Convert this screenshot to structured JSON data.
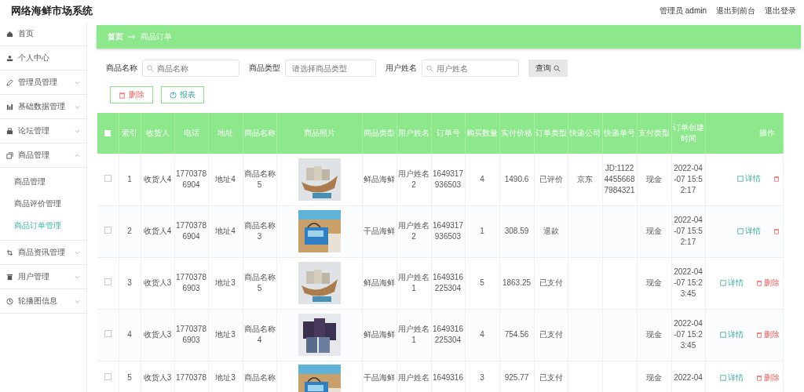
{
  "header": {
    "title": "网络海鲜市场系统",
    "user": "管理员 admin",
    "links": [
      "退出到前台",
      "退出登录"
    ]
  },
  "sidebar": {
    "items": [
      {
        "label": "首页"
      },
      {
        "label": "个人中心"
      },
      {
        "label": "管理员管理",
        "expanded": false
      },
      {
        "label": "基础数据管理",
        "expanded": false
      },
      {
        "label": "论坛管理",
        "expanded": false
      },
      {
        "label": "商品管理",
        "expanded": true,
        "children": [
          {
            "label": "商品管理",
            "selected": false
          },
          {
            "label": "商品评价管理",
            "selected": false
          },
          {
            "label": "商品订单管理",
            "selected": true
          }
        ]
      },
      {
        "label": "商品资讯管理",
        "expanded": false
      },
      {
        "label": "用户管理",
        "expanded": false
      },
      {
        "label": "轮播图信息",
        "expanded": false
      }
    ]
  },
  "breadcrumb": [
    "首页",
    "商品订单"
  ],
  "search": {
    "fields": [
      {
        "label": "商品名称",
        "placeholder": "商品名称",
        "kind": "input"
      },
      {
        "label": "商品类型",
        "placeholder": "请选择商品类型",
        "kind": "select"
      },
      {
        "label": "用户姓名",
        "placeholder": "用户姓名",
        "kind": "input"
      }
    ],
    "button": "查询"
  },
  "actions": {
    "delete": "删除",
    "report": "报表"
  },
  "table": {
    "all_checked": false,
    "columns": [
      "索引",
      "收货人",
      "电话",
      "地址",
      "商品名称",
      "商品照片",
      "商品类型",
      "用户姓名",
      "订单号",
      "购买数量",
      "实付价格",
      "订单类型",
      "快递公司",
      "快递单号",
      "支付类型",
      "订单创建时间",
      "操作"
    ],
    "rows": [
      {
        "checked": false,
        "cells": [
          "1",
          "收货人4",
          "17703786904",
          "地址4",
          "商品名称5",
          "",
          "鲜品海鲜",
          "用户姓名2",
          "1649317936503",
          "4",
          "1490.6",
          "已评价",
          "京东",
          "JD:112244556687984321",
          "现金",
          "2022-04-07 15:52:17"
        ],
        "detail": "详情"
      },
      {
        "checked": false,
        "cells": [
          "2",
          "收货人4",
          "17703786904",
          "地址4",
          "商品名称3",
          "",
          "干品海鲜",
          "用户姓名2",
          "1649317936503",
          "1",
          "308.59",
          "退款",
          "",
          "",
          "现金",
          "2022-04-07 15:52:17"
        ],
        "detail": "详情"
      },
      {
        "checked": false,
        "cells": [
          "3",
          "收货人3",
          "17703786903",
          "地址3",
          "商品名称5",
          "",
          "鲜品海鲜",
          "用户姓名1",
          "1649316225304",
          "5",
          "1863.25",
          "已支付",
          "",
          "",
          "现金",
          "2022-04-07 15:23:45"
        ],
        "detail": "详情",
        "delete": "删除"
      },
      {
        "checked": false,
        "cells": [
          "4",
          "收货人3",
          "17703786903",
          "地址3",
          "商品名称4",
          "",
          "鲜品海鲜",
          "用户姓名1",
          "1649316225304",
          "4",
          "754.56",
          "已支付",
          "",
          "",
          "现金",
          "2022-04-07 15:23:45"
        ],
        "detail": "详情",
        "delete": "删除"
      },
      {
        "checked": false,
        "cells": [
          "5",
          "收货人3",
          "1770378",
          "地址3",
          "商品名称",
          "",
          "干品海鲜",
          "用户姓名",
          "1649316",
          "3",
          "925.77",
          "已支付",
          "",
          "",
          "现金",
          "2022-04"
        ],
        "detail": "详情",
        "delete": "删除"
      }
    ]
  }
}
